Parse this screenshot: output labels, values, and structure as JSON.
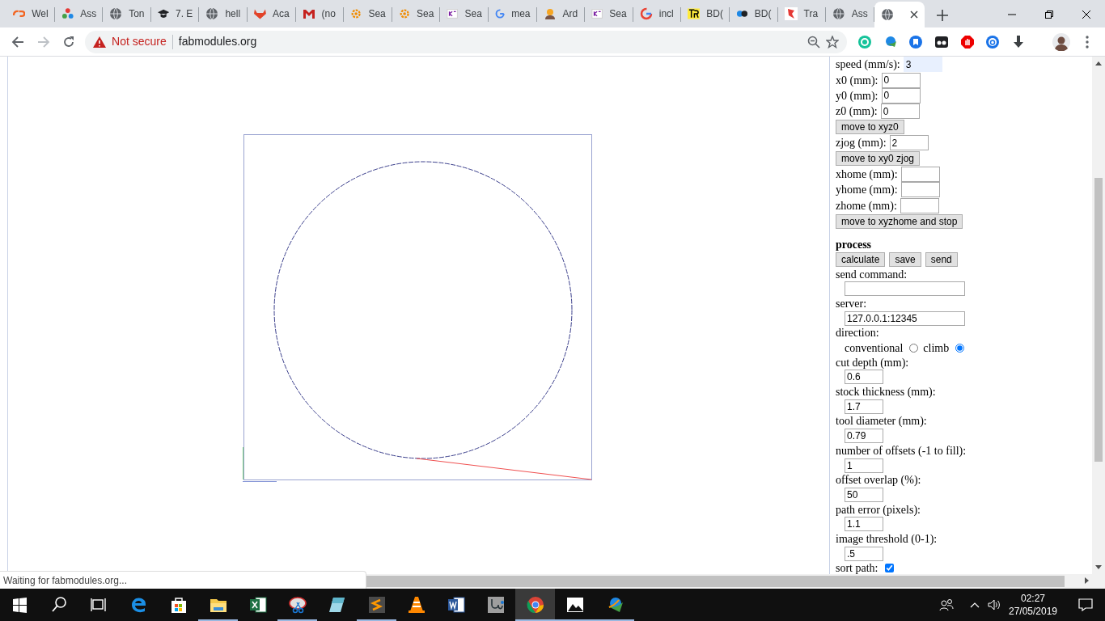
{
  "tabs": [
    {
      "title": "Wel",
      "selected": false
    },
    {
      "title": "Ass",
      "selected": false
    },
    {
      "title": "Ton",
      "selected": false
    },
    {
      "title": "7. E",
      "selected": false
    },
    {
      "title": "hell",
      "selected": false
    },
    {
      "title": "Aca",
      "selected": false
    },
    {
      "title": "(no",
      "selected": false
    },
    {
      "title": "Sea",
      "selected": false
    },
    {
      "title": "Sea",
      "selected": false
    },
    {
      "title": "Sea",
      "selected": false
    },
    {
      "title": "mea",
      "selected": false
    },
    {
      "title": "Ard",
      "selected": false
    },
    {
      "title": "Sea",
      "selected": false
    },
    {
      "title": "incl",
      "selected": false
    },
    {
      "title": "BD(",
      "selected": false
    },
    {
      "title": "BD(",
      "selected": false
    },
    {
      "title": "Tra",
      "selected": false
    },
    {
      "title": "Ass",
      "selected": false
    },
    {
      "selected": true
    }
  ],
  "address_bar": {
    "security": "Not secure",
    "url": "fabmodules.org"
  },
  "form": [
    {
      "kind": "inline",
      "label": "speed (mm/s):",
      "value": "3",
      "highlighted": true
    },
    {
      "kind": "inline",
      "label": "x0 (mm):",
      "value": "0",
      "highlighted": false
    },
    {
      "kind": "inline",
      "label": "y0 (mm):",
      "value": "0",
      "highlighted": false
    },
    {
      "kind": "inline",
      "label": "z0 (mm):",
      "value": "0",
      "highlighted": false
    },
    {
      "kind": "button",
      "label": "move to xyz0"
    },
    {
      "kind": "inline",
      "label": "zjog (mm):",
      "value": "2",
      "highlighted": false
    },
    {
      "kind": "button",
      "label": "move to xy0 zjog"
    },
    {
      "kind": "inline",
      "label": "xhome (mm):",
      "highlighted": false
    },
    {
      "kind": "inline",
      "label": "yhome (mm):",
      "highlighted": false
    },
    {
      "kind": "inline",
      "label": "zhome (mm):",
      "highlighted": false
    },
    {
      "kind": "button",
      "label": "move to xyzhome and stop"
    },
    {
      "kind": "heading",
      "label": "process"
    },
    {
      "kind": "buttons",
      "labels": [
        "calculate",
        "save",
        "send"
      ]
    },
    {
      "kind": "stacked",
      "label": "send command:",
      "wide": true
    },
    {
      "kind": "stacked",
      "label": "server:",
      "value": "127.0.0.1:12345",
      "wide": true
    },
    {
      "kind": "radio",
      "label": "direction:",
      "options": [
        {
          "label": "conventional",
          "selected": false
        },
        {
          "label": "climb",
          "selected": true
        }
      ]
    },
    {
      "kind": "stacked",
      "label": "cut depth (mm):",
      "value": "0.6",
      "wide": false
    },
    {
      "kind": "stacked",
      "label": "stock thickness (mm):",
      "value": "1.7",
      "wide": false
    },
    {
      "kind": "stacked",
      "label": "tool diameter (mm):",
      "value": "0.79",
      "wide": false
    },
    {
      "kind": "stacked",
      "label": "number of offsets (-1 to fill):",
      "value": "1",
      "wide": false
    },
    {
      "kind": "stacked",
      "label": "offset overlap (%):",
      "value": "50",
      "wide": false
    },
    {
      "kind": "stacked",
      "label": "path error (pixels):",
      "value": "1.1",
      "wide": false
    },
    {
      "kind": "stacked",
      "label": "image threshold (0-1):",
      "value": ".5",
      "wide": false
    },
    {
      "kind": "checkbox",
      "label": "sort path:",
      "checked": true
    }
  ],
  "status": "Waiting for fabmodules.org...",
  "taskbar_apps": [
    {
      "running": false,
      "selected": false
    },
    {
      "running": false,
      "selected": false
    },
    {
      "running": true,
      "selected": false
    },
    {
      "running": false,
      "selected": false
    },
    {
      "running": true,
      "selected": false
    },
    {
      "running": false,
      "selected": false
    },
    {
      "running": true,
      "selected": false
    },
    {
      "running": false,
      "selected": false
    },
    {
      "running": false,
      "selected": false
    },
    {
      "running": false,
      "selected": false
    },
    {
      "running": true,
      "selected": true
    },
    {
      "running": true,
      "selected": false
    },
    {
      "running": true,
      "selected": false
    }
  ],
  "clock": {
    "time": "02:27",
    "date": "27/05/2019"
  }
}
